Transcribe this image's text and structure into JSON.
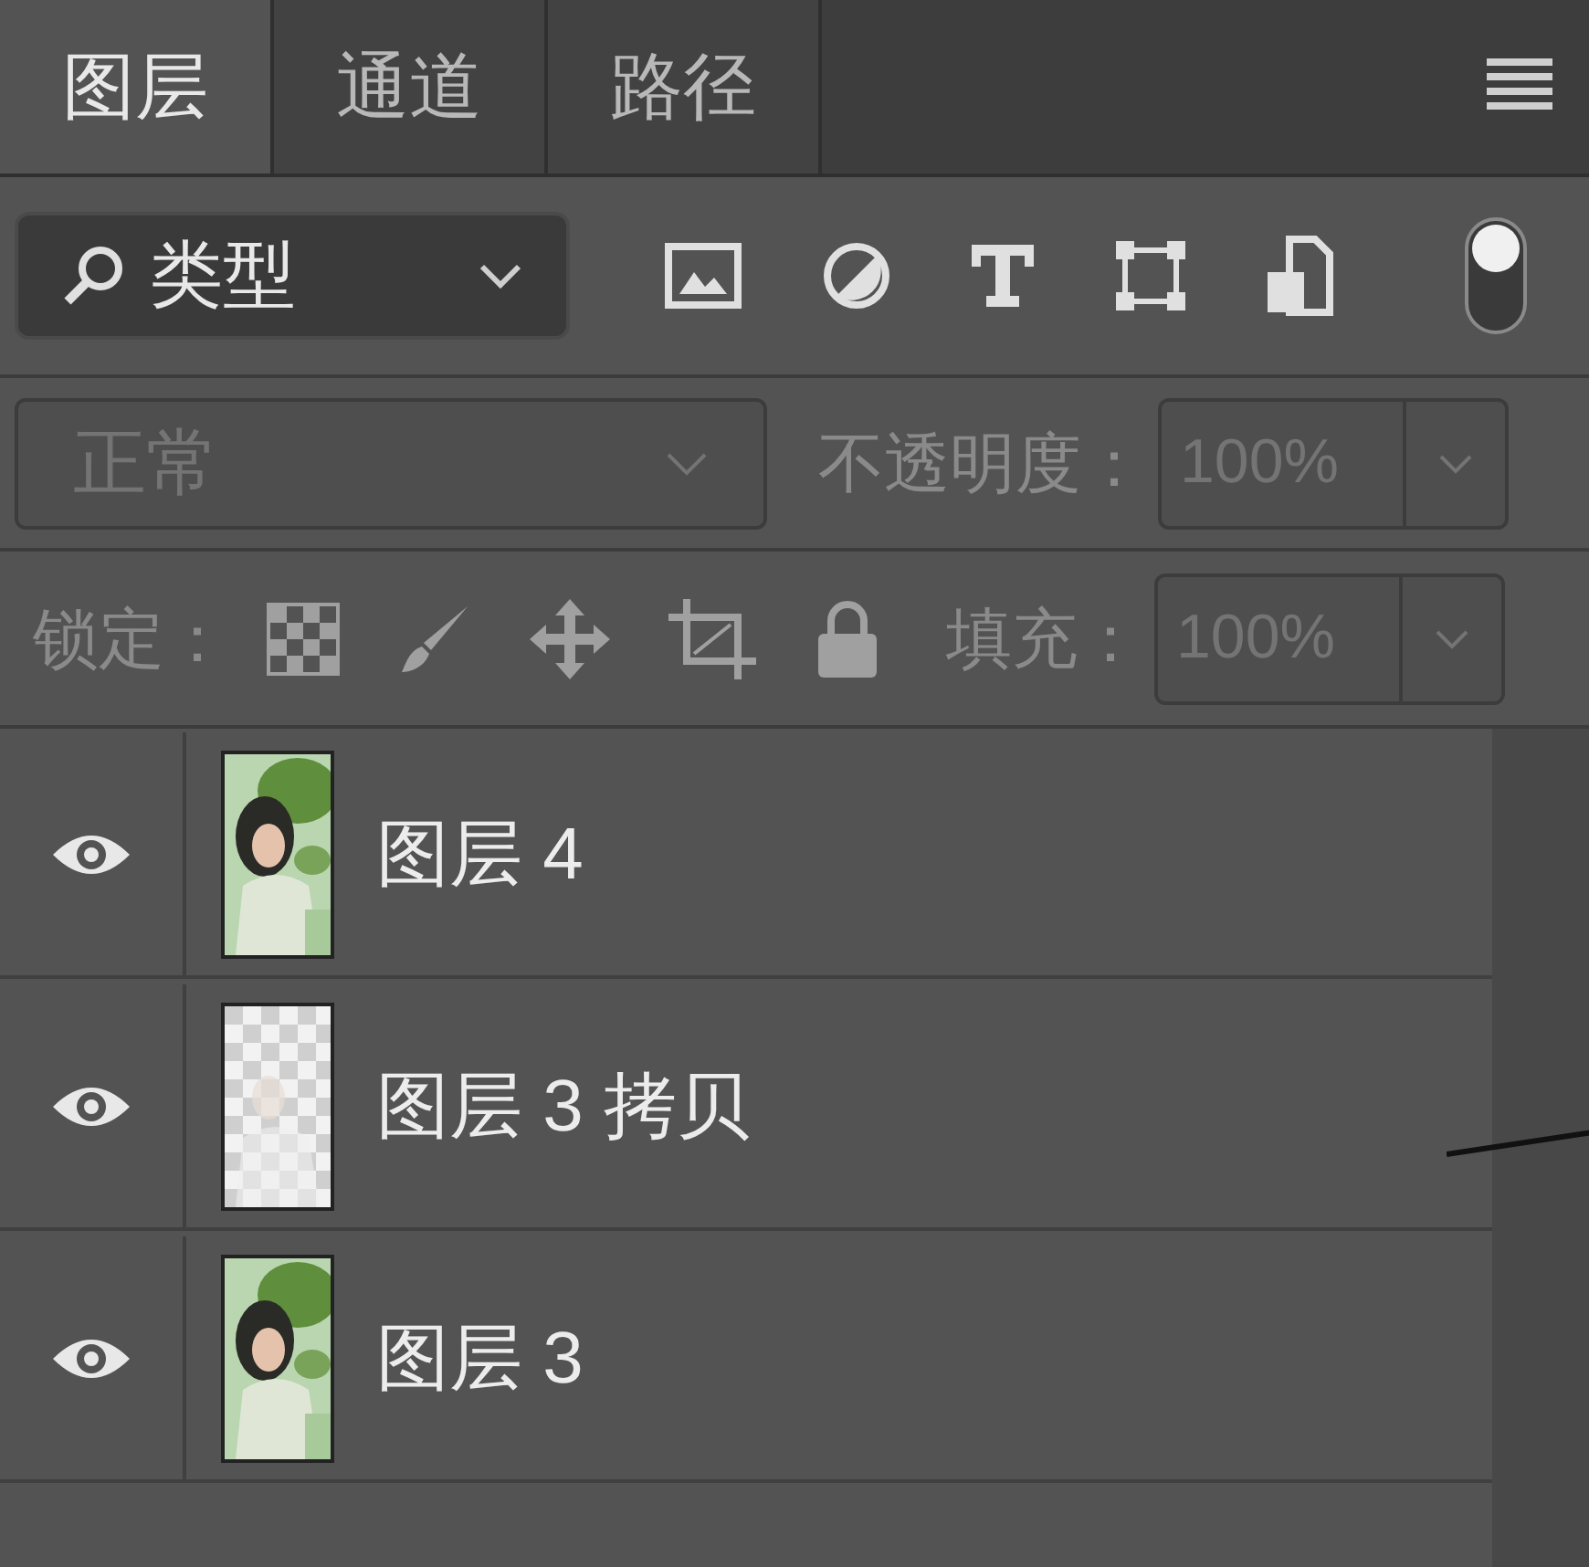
{
  "tabs": [
    {
      "label": "图层",
      "selected": true
    },
    {
      "label": "通道",
      "selected": false
    },
    {
      "label": "路径",
      "selected": false
    }
  ],
  "filter": {
    "value": "类型",
    "toggle_on": true
  },
  "blend_mode": {
    "value": "正常",
    "disabled": true
  },
  "opacity": {
    "label": "不透明度：",
    "value": "100%",
    "disabled": true
  },
  "lock": {
    "label": "锁定："
  },
  "fill": {
    "label": "填充：",
    "value": "100%",
    "disabled": true
  },
  "layers": [
    {
      "name": "图层 4",
      "visible": true
    },
    {
      "name": "图层 3 拷贝",
      "visible": true,
      "kind": "transparent"
    },
    {
      "name": "图层 3",
      "visible": true
    }
  ]
}
